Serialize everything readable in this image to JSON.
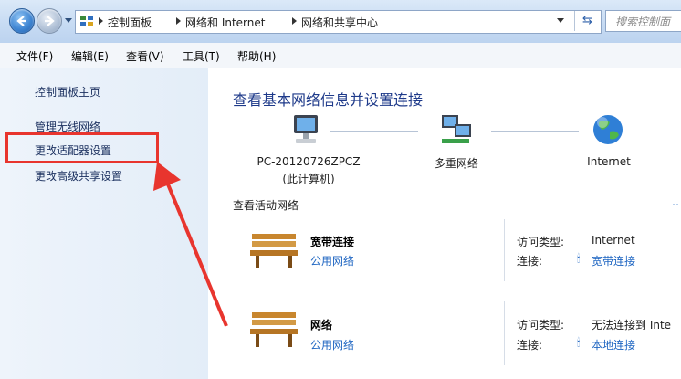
{
  "address_bar": {
    "breadcrumbs": [
      "控制面板",
      "网络和 Internet",
      "网络和共享中心"
    ],
    "search_placeholder": "搜索控制面"
  },
  "menu": [
    "文件(F)",
    "编辑(E)",
    "查看(V)",
    "工具(T)",
    "帮助(H)"
  ],
  "sidebar": {
    "items": [
      {
        "label": "控制面板主页"
      },
      {
        "label": "管理无线网络"
      },
      {
        "label": "更改适配器设置",
        "highlighted": true
      },
      {
        "label": "更改高级共享设置"
      }
    ]
  },
  "main": {
    "heading": "查看基本网络信息并设置连接",
    "map": {
      "computer_name": "PC-20120726ZPCZ",
      "computer_sub": "(此计算机)",
      "network": "多重网络",
      "internet": "Internet"
    },
    "active_title": "查看活动网络",
    "networks": [
      {
        "name": "宽带连接",
        "type_link": "公用网络",
        "access_label": "访问类型:",
        "access_value": "Internet",
        "conn_label": "连接:",
        "conn_value": "宽带连接"
      },
      {
        "name": "网络",
        "type_link": "公用网络",
        "access_label": "访问类型:",
        "access_value": "无法连接到 Inte",
        "conn_label": "连接:",
        "conn_value": "本地连接"
      }
    ]
  },
  "colors": {
    "annotation": "#e8352e",
    "link": "#1f66c2",
    "heading": "#1e3a8a"
  }
}
